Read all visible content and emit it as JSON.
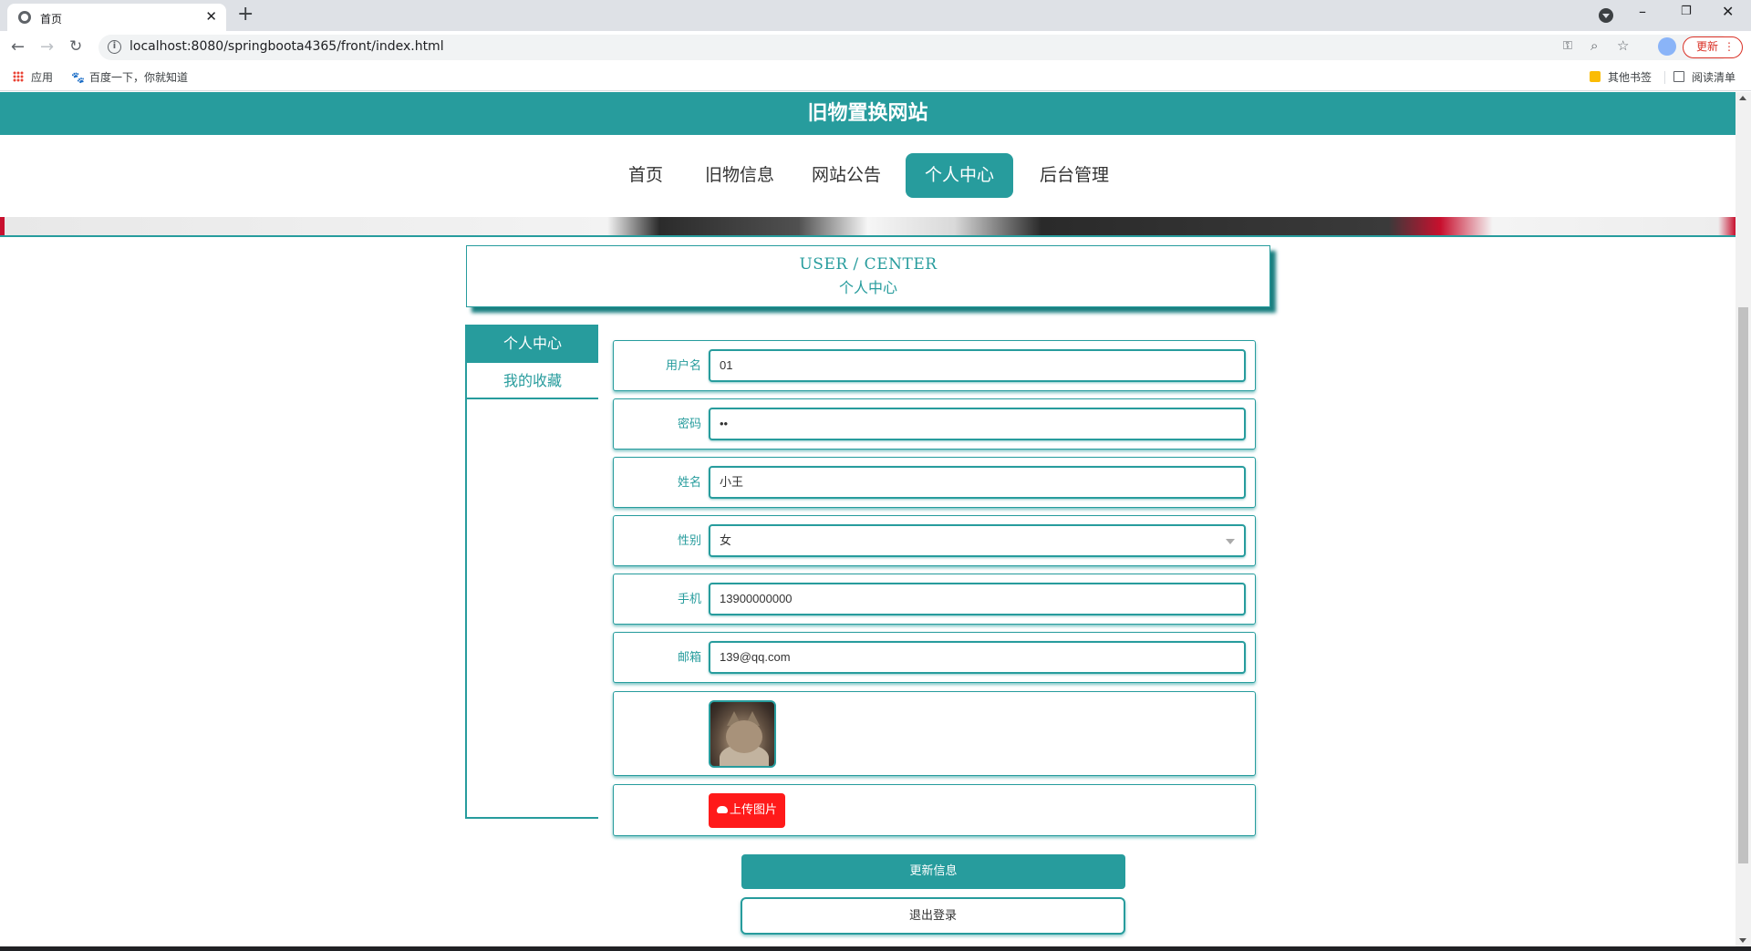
{
  "browser": {
    "tab_title": "首页",
    "tab_close": "✕",
    "new_tab": "+",
    "url": "localhost:8080/springboota4365/front/index.html",
    "update_label": "更新",
    "update_menu": "⋮",
    "window": {
      "minimize": "–",
      "restore": "❐",
      "close": "✕"
    },
    "bookmarks": {
      "apps": "应用",
      "baidu": "百度一下，你就知道",
      "other": "其他书签",
      "reading": "阅读清单"
    },
    "icons": [
      "back-icon",
      "forward-icon",
      "reload-icon",
      "info-icon",
      "key-icon",
      "zoom-icon",
      "star-icon",
      "profile-icon",
      "apps-icon",
      "paw-icon",
      "folder-icon",
      "reading-list-icon"
    ]
  },
  "site": {
    "title": "旧物置换网站",
    "nav": [
      "首页",
      "旧物信息",
      "网站公告",
      "个人中心",
      "后台管理"
    ],
    "active_nav": "个人中心",
    "accent_color": "#279c9d",
    "section_title_en": "USER / CENTER",
    "section_title_cn": "个人中心",
    "side_menu": [
      "个人中心",
      "我的收藏"
    ],
    "form": {
      "username_label": "用户名",
      "username": "01",
      "password_label": "密码",
      "password": "••",
      "name_label": "姓名",
      "name": "小王",
      "gender_label": "性别",
      "gender": "女",
      "phone_label": "手机",
      "phone": "13900000000",
      "email_label": "邮箱",
      "email": "139@qq.com"
    },
    "upload_label": "上传图片",
    "upload_color": "#ff1a1a",
    "update_button": "更新信息",
    "logout_button": "退出登录"
  }
}
